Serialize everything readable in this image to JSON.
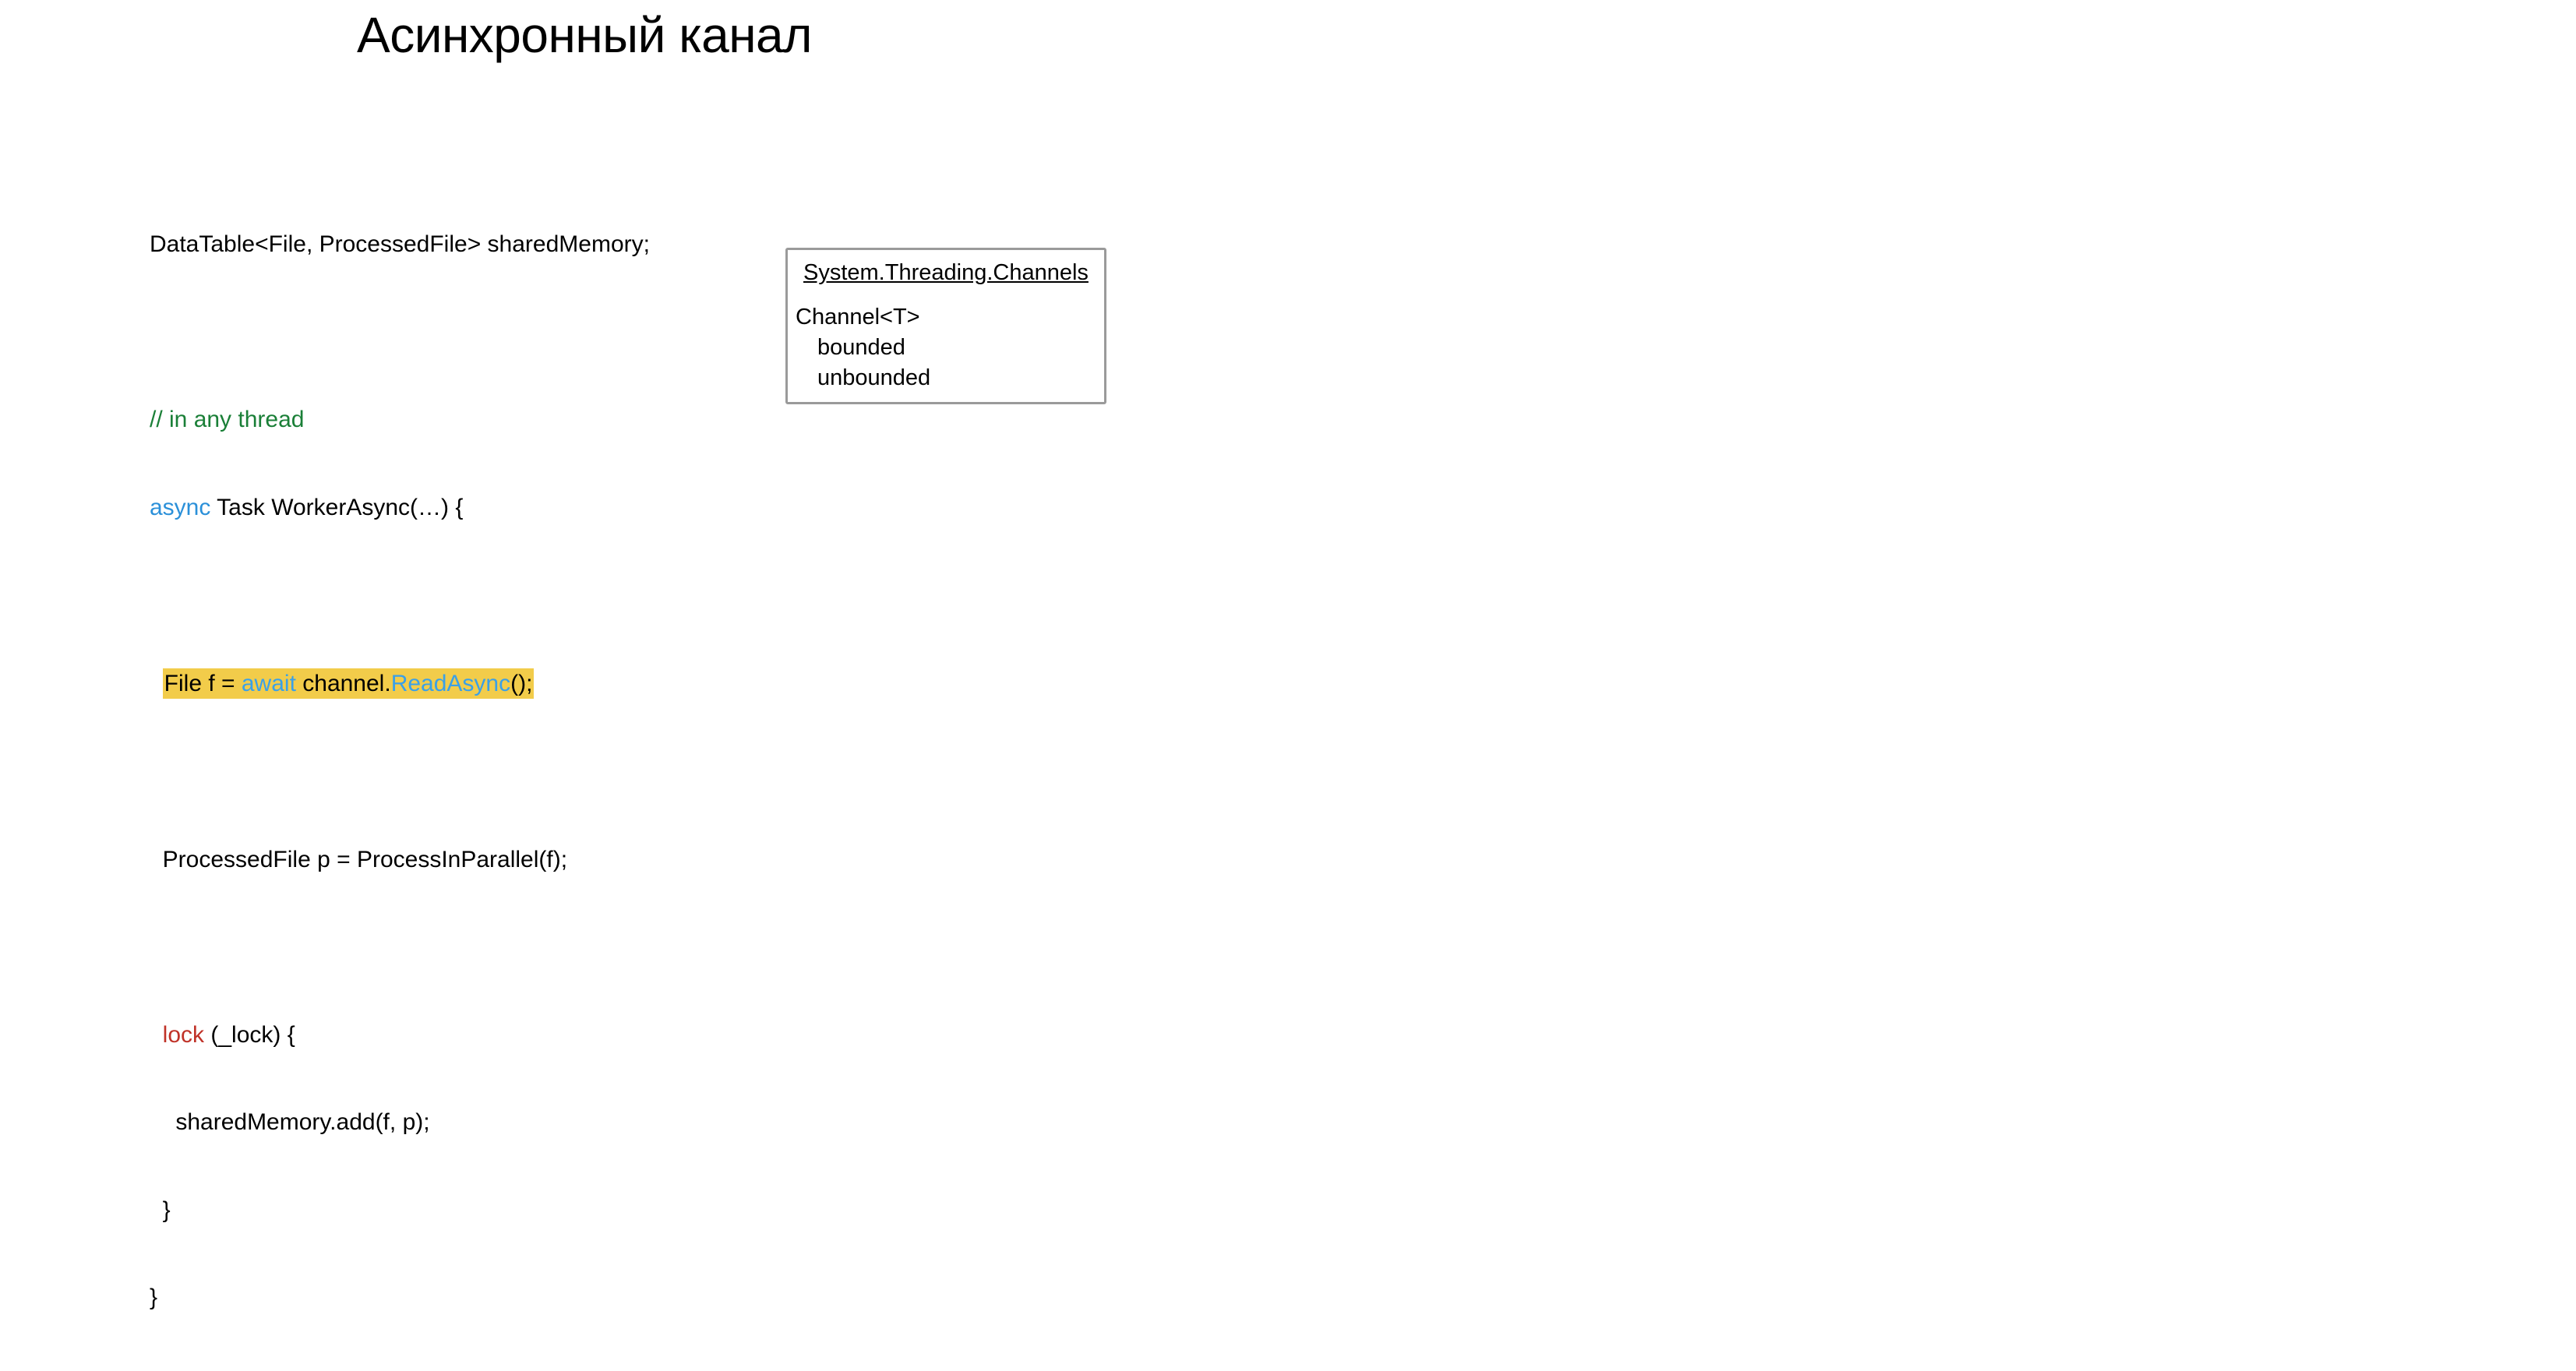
{
  "title": "Асинхронный канал",
  "code": {
    "l1": "DataTable<File, ProcessedFile> sharedMemory;",
    "l2": "// in any thread",
    "l3a": "async",
    "l3b": " Task WorkerAsync(…) {",
    "l4a": "File f = ",
    "l4b": "await",
    "l4c": " channel.",
    "l4d": "ReadAsync",
    "l4e": "();",
    "l5": "  ProcessedFile p = ProcessInParallel(f);",
    "l6a": "  ",
    "l6b": "lock",
    "l6c": " (_lock) {",
    "l7": "    sharedMemory.add(f, p);",
    "l8": "  }",
    "l9": "}"
  },
  "sidebox": {
    "heading": "System.Threading.Channels",
    "line1": "Channel<T>",
    "line2": "bounded",
    "line3": "unbounded"
  }
}
